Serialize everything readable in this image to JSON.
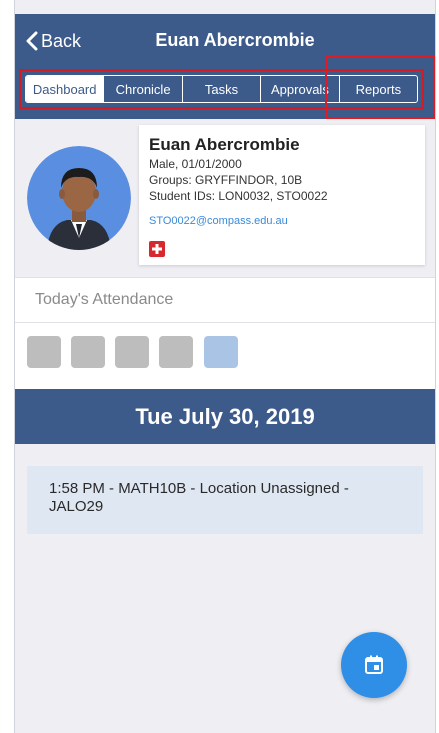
{
  "header": {
    "back_label": "Back",
    "title": "Euan Abercrombie"
  },
  "tabs": [
    {
      "label": "Dashboard",
      "active": true
    },
    {
      "label": "Chronicle",
      "active": false
    },
    {
      "label": "Tasks",
      "active": false
    },
    {
      "label": "Approvals",
      "active": false
    },
    {
      "label": "Reports",
      "active": false
    }
  ],
  "profile": {
    "name": "Euan Abercrombie",
    "details": "Male, 01/01/2000",
    "groups": "Groups: GRYFFINDOR, 10B",
    "student_ids": "Student IDs: LON0032, STO0022",
    "email": "STO0022@compass.edu.au",
    "medical_icon": "medical-cross-icon"
  },
  "attendance": {
    "label": "Today's Attendance",
    "boxes": [
      "#bdbdbd",
      "#bdbdbd",
      "#bdbdbd",
      "#bdbdbd",
      "#a9c4e4"
    ]
  },
  "date": "Tue July 30, 2019",
  "events": [
    {
      "text": "1:58 PM - MATH10B - Location Unassigned - JALO29"
    }
  ],
  "fab": {
    "icon": "calendar-icon"
  },
  "colors": {
    "header_bg": "#3c5a8a",
    "highlight": "#e01b24",
    "email": "#3b8ad9",
    "fab": "#2f8ee6"
  }
}
